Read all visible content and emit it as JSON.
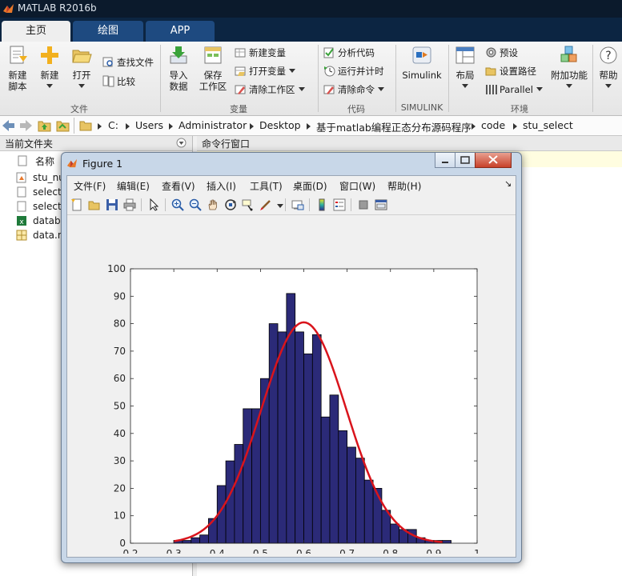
{
  "window": {
    "title": "MATLAB R2016b"
  },
  "tabs": [
    {
      "label": "主页",
      "active": true
    },
    {
      "label": "绘图",
      "active": false
    },
    {
      "label": "APP",
      "active": false
    }
  ],
  "ribbon": {
    "file": {
      "group_label": "文件",
      "new_script": "新建\n脚本",
      "new": "新建",
      "open": "打开",
      "find_files": "查找文件",
      "compare": "比较"
    },
    "variable": {
      "group_label": "变量",
      "import": "导入\n数据",
      "save_workspace": "保存\n工作区",
      "new_variable": "新建变量",
      "open_variable": "打开变量",
      "clear_workspace": "清除工作区"
    },
    "code": {
      "group_label": "代码",
      "analyze": "分析代码",
      "run_time": "运行并计时",
      "clear_commands": "清除命令"
    },
    "simulink": {
      "group_label": "SIMULINK",
      "simulink": "Simulink"
    },
    "environment": {
      "group_label": "环境",
      "layout": "布局",
      "preferences": "预设",
      "set_path": "设置路径",
      "parallel": "Parallel",
      "addons": "附加功能"
    },
    "help": "帮助"
  },
  "address": {
    "crumbs": [
      "C:",
      "Users",
      "Administrator",
      "Desktop",
      "基于matlab编程正态分布源码程序",
      "code",
      "stu_select"
    ]
  },
  "current_folder": {
    "title": "当前文件夹",
    "column_name": "名称",
    "files": [
      "stu_nu",
      "select",
      "select",
      "datab",
      "data.n"
    ]
  },
  "command_window": {
    "title": "命令行窗口"
  },
  "figure": {
    "title": "Figure 1",
    "menus": [
      "文件(F)",
      "编辑(E)",
      "查看(V)",
      "插入(I)",
      "工具(T)",
      "桌面(D)",
      "窗口(W)",
      "帮助(H)"
    ]
  },
  "colors": {
    "bar": "#2b2a78",
    "curve": "#d9141c",
    "tab_bar": "#0c2542"
  },
  "chart_data": {
    "type": "bar",
    "title": "",
    "xlabel": "",
    "ylabel": "",
    "xlim": [
      0.2,
      1
    ],
    "ylim": [
      0,
      100
    ],
    "xticks": [
      "0.2",
      "0.3",
      "0.4",
      "0.5",
      "0.6",
      "0.7",
      "0.8",
      "0.9",
      "1"
    ],
    "yticks": [
      "0",
      "10",
      "20",
      "30",
      "40",
      "50",
      "60",
      "70",
      "80",
      "90",
      "100"
    ],
    "bin_width": 0.02,
    "bin_centers": [
      0.31,
      0.33,
      0.35,
      0.37,
      0.39,
      0.41,
      0.43,
      0.45,
      0.47,
      0.49,
      0.51,
      0.53,
      0.55,
      0.57,
      0.59,
      0.61,
      0.63,
      0.65,
      0.67,
      0.69,
      0.71,
      0.73,
      0.75,
      0.77,
      0.79,
      0.81,
      0.83,
      0.85,
      0.87,
      0.89,
      0.91,
      0.93
    ],
    "values": [
      1,
      1,
      2,
      3,
      9,
      21,
      30,
      36,
      49,
      49,
      60,
      80,
      77,
      91,
      77,
      69,
      76,
      46,
      54,
      41,
      35,
      31,
      23,
      20,
      12,
      7,
      5,
      5,
      2,
      1,
      1,
      1
    ],
    "curve": {
      "name": "",
      "mean": 0.6,
      "sigma": 0.098,
      "peak": 80.5
    }
  }
}
